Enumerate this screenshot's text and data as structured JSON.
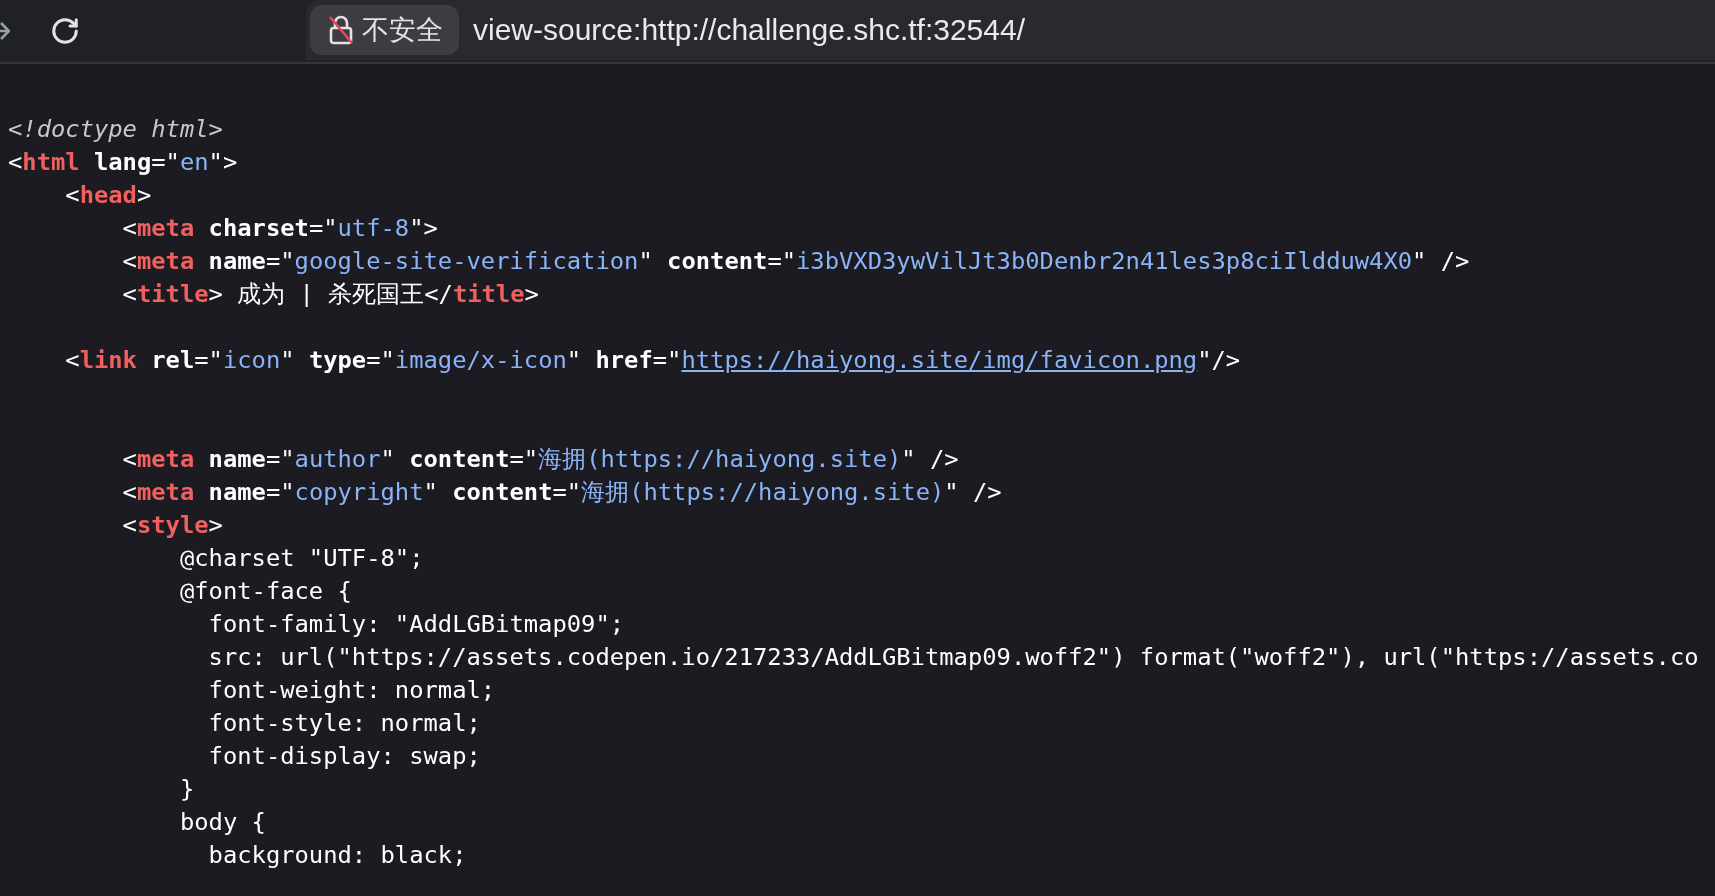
{
  "toolbar": {
    "security_label": "不安全",
    "url": "view-source:http://challenge.shc.tf:32544/"
  },
  "source_lines": [
    {
      "kind": "code",
      "tokens": [
        {
          "kind": "comment",
          "text": "<!doctype html>"
        }
      ]
    },
    {
      "kind": "code",
      "tokens": [
        {
          "kind": "punct",
          "text": "<"
        },
        {
          "kind": "tag",
          "text": "html"
        },
        {
          "kind": "attr",
          "text": " lang"
        },
        {
          "kind": "punct",
          "text": "=\""
        },
        {
          "kind": "value",
          "text": "en"
        },
        {
          "kind": "punct",
          "text": "\">"
        }
      ]
    },
    {
      "kind": "code",
      "tokens": [
        {
          "kind": "punct",
          "text": "    <"
        },
        {
          "kind": "tag",
          "text": "head"
        },
        {
          "kind": "punct",
          "text": ">"
        }
      ]
    },
    {
      "kind": "code",
      "tokens": [
        {
          "kind": "punct",
          "text": "        <"
        },
        {
          "kind": "tag",
          "text": "meta"
        },
        {
          "kind": "attr",
          "text": " charset"
        },
        {
          "kind": "punct",
          "text": "=\""
        },
        {
          "kind": "value",
          "text": "utf-8"
        },
        {
          "kind": "punct",
          "text": "\">"
        }
      ]
    },
    {
      "kind": "code",
      "tokens": [
        {
          "kind": "punct",
          "text": "        <"
        },
        {
          "kind": "tag",
          "text": "meta"
        },
        {
          "kind": "attr",
          "text": " name"
        },
        {
          "kind": "punct",
          "text": "=\""
        },
        {
          "kind": "value",
          "text": "google-site-verification"
        },
        {
          "kind": "punct",
          "text": "\" "
        },
        {
          "kind": "attr",
          "text": "content"
        },
        {
          "kind": "punct",
          "text": "=\""
        },
        {
          "kind": "value",
          "text": "i3bVXD3ywVilJt3b0Denbr2n41les3p8ciIldduw4X0"
        },
        {
          "kind": "punct",
          "text": "\" />"
        }
      ]
    },
    {
      "kind": "code",
      "tokens": [
        {
          "kind": "punct",
          "text": "        <"
        },
        {
          "kind": "tag",
          "text": "title"
        },
        {
          "kind": "punct",
          "text": ">"
        },
        {
          "kind": "text",
          "text": " 成为 | 杀死国王"
        },
        {
          "kind": "punct",
          "text": "</"
        },
        {
          "kind": "tag",
          "text": "title"
        },
        {
          "kind": "punct",
          "text": ">"
        }
      ]
    },
    {
      "kind": "blank"
    },
    {
      "kind": "code",
      "tokens": [
        {
          "kind": "punct",
          "text": "    <"
        },
        {
          "kind": "tag",
          "text": "link"
        },
        {
          "kind": "attr",
          "text": " rel"
        },
        {
          "kind": "punct",
          "text": "=\""
        },
        {
          "kind": "value",
          "text": "icon"
        },
        {
          "kind": "punct",
          "text": "\" "
        },
        {
          "kind": "attr",
          "text": "type"
        },
        {
          "kind": "punct",
          "text": "=\""
        },
        {
          "kind": "value",
          "text": "image/x-icon"
        },
        {
          "kind": "punct",
          "text": "\" "
        },
        {
          "kind": "attr",
          "text": "href"
        },
        {
          "kind": "punct",
          "text": "=\""
        },
        {
          "kind": "link",
          "text": "https://haiyong.site/img/favicon.png"
        },
        {
          "kind": "punct",
          "text": "\"/>"
        }
      ]
    },
    {
      "kind": "blank"
    },
    {
      "kind": "blank"
    },
    {
      "kind": "code",
      "tokens": [
        {
          "kind": "punct",
          "text": "        <"
        },
        {
          "kind": "tag",
          "text": "meta"
        },
        {
          "kind": "attr",
          "text": " name"
        },
        {
          "kind": "punct",
          "text": "=\""
        },
        {
          "kind": "value",
          "text": "author"
        },
        {
          "kind": "punct",
          "text": "\" "
        },
        {
          "kind": "attr",
          "text": "content"
        },
        {
          "kind": "punct",
          "text": "=\""
        },
        {
          "kind": "value",
          "text": "海拥(https://haiyong.site)"
        },
        {
          "kind": "punct",
          "text": "\" />"
        }
      ]
    },
    {
      "kind": "code",
      "tokens": [
        {
          "kind": "punct",
          "text": "        <"
        },
        {
          "kind": "tag",
          "text": "meta"
        },
        {
          "kind": "attr",
          "text": " name"
        },
        {
          "kind": "punct",
          "text": "=\""
        },
        {
          "kind": "value",
          "text": "copyright"
        },
        {
          "kind": "punct",
          "text": "\" "
        },
        {
          "kind": "attr",
          "text": "content"
        },
        {
          "kind": "punct",
          "text": "=\""
        },
        {
          "kind": "value",
          "text": "海拥(https://haiyong.site)"
        },
        {
          "kind": "punct",
          "text": "\" />"
        }
      ]
    },
    {
      "kind": "code",
      "tokens": [
        {
          "kind": "punct",
          "text": "        <"
        },
        {
          "kind": "tag",
          "text": "style"
        },
        {
          "kind": "punct",
          "text": ">"
        }
      ]
    },
    {
      "kind": "code",
      "tokens": [
        {
          "kind": "text",
          "text": "            @charset \"UTF-8\";"
        }
      ]
    },
    {
      "kind": "code",
      "tokens": [
        {
          "kind": "text",
          "text": "            @font-face {"
        }
      ]
    },
    {
      "kind": "code",
      "tokens": [
        {
          "kind": "text",
          "text": "              font-family: \"AddLGBitmap09\";"
        }
      ]
    },
    {
      "kind": "code",
      "tokens": [
        {
          "kind": "text",
          "text": "              src: url(\"https://assets.codepen.io/217233/AddLGBitmap09.woff2\") format(\"woff2\"), url(\"https://assets.co"
        }
      ]
    },
    {
      "kind": "code",
      "tokens": [
        {
          "kind": "text",
          "text": "              font-weight: normal;"
        }
      ]
    },
    {
      "kind": "code",
      "tokens": [
        {
          "kind": "text",
          "text": "              font-style: normal;"
        }
      ]
    },
    {
      "kind": "code",
      "tokens": [
        {
          "kind": "text",
          "text": "              font-display: swap;"
        }
      ]
    },
    {
      "kind": "code",
      "tokens": [
        {
          "kind": "text",
          "text": "            }"
        }
      ]
    },
    {
      "kind": "code",
      "tokens": [
        {
          "kind": "text",
          "text": "            body {"
        }
      ]
    },
    {
      "kind": "code",
      "tokens": [
        {
          "kind": "text",
          "text": "              background: black;"
        }
      ]
    }
  ]
}
